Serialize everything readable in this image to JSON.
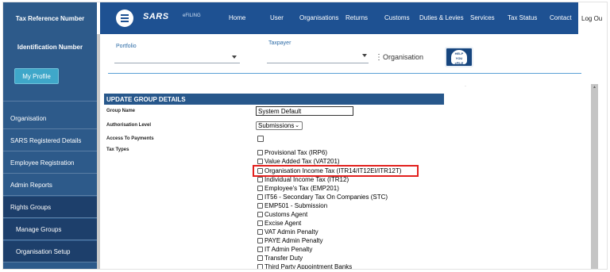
{
  "sidebar": {
    "tax_reference_label": "Tax Reference Number",
    "identification_label": "Identification Number",
    "profile_button": "My Profile",
    "items": [
      {
        "label": "Organisation"
      },
      {
        "label": "SARS Registered Details"
      },
      {
        "label": "Employee Registration"
      },
      {
        "label": "Admin Reports"
      },
      {
        "label": "Rights Groups"
      },
      {
        "label": "Manage Groups"
      },
      {
        "label": "Organisation Setup"
      }
    ]
  },
  "header": {
    "logo_text": "SARS",
    "logo_sub": "eFILING",
    "nav": [
      "Home",
      "User",
      "Organisations",
      "Returns",
      "Customs",
      "Duties & Levies",
      "Services",
      "Tax Status",
      "Contact"
    ],
    "logout": "Log Ou"
  },
  "filters": {
    "portfolio_label": "Portfolio",
    "taxpayer_label": "Taxpayer",
    "organisation_label": "Organisation",
    "help_icon_text": "HELP YOU eFILE"
  },
  "form": {
    "section_title": "UPDATE GROUP DETAILS",
    "group_name_label": "Group Name",
    "group_name_value": "System Default",
    "auth_level_label": "Authorisation Level",
    "auth_level_value": "Submissions",
    "access_payments_label": "Access To Payments",
    "tax_types_label": "Tax Types",
    "tax_types": [
      "Provisional Tax (IRP6)",
      "Value Added Tax (VAT201)",
      "Organisation Income Tax (ITR14/IT12EI/ITR12T)",
      "Individual Income Tax (ITR12)",
      "Employee's Tax (EMP201)",
      "IT56 - Secondary Tax On Companies (STC)",
      "EMP501 - Submission",
      "Customs Agent",
      "Excise Agent",
      "VAT Admin Penalty",
      "PAYE Admin Penalty",
      "IT Admin Penalty",
      "Transfer Duty",
      "Third Party Appointment Banks"
    ]
  },
  "colors": {
    "sidebar_bg": "#2d5a8a",
    "nav_bg": "#1e5192",
    "section_header_bg": "#27578b",
    "highlight": "#e2201d"
  }
}
